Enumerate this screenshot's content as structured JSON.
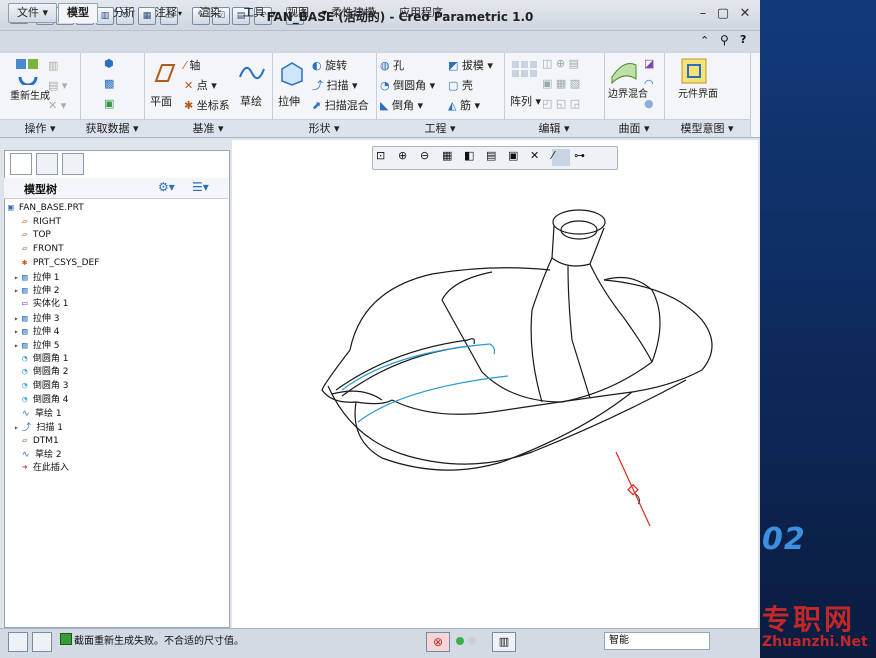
{
  "window": {
    "title": "FAN_BASE (活动的) - Creo Parametric 1.0"
  },
  "tabs": [
    {
      "label": "文件",
      "has_dropdown": true
    },
    {
      "label": "模型"
    },
    {
      "label": "分析"
    },
    {
      "label": "注释"
    },
    {
      "label": "渲染"
    },
    {
      "label": "工具"
    },
    {
      "label": "视图"
    },
    {
      "label": "柔性建模"
    },
    {
      "label": "应用程序"
    }
  ],
  "ribbon": {
    "operations": {
      "regen_label": "重新生成",
      "group": "操作"
    },
    "get_data": {
      "group": "获取数据"
    },
    "datum": {
      "plane": "平面",
      "axis": "轴",
      "point": "点",
      "csys": "坐标系",
      "sketch": "草绘",
      "group": "基准"
    },
    "shape": {
      "extrude": "拉伸",
      "revolve": "旋转",
      "sweep": "扫描",
      "swept_blend": "扫描混合",
      "group": "形状"
    },
    "engineering": {
      "hole": "孔",
      "round": "倒圆角",
      "chamfer": "倒角",
      "draft": "拔模",
      "shell": "壳",
      "rib": "筋",
      "group": "工程"
    },
    "editing": {
      "pattern": "阵列",
      "group": "编辑"
    },
    "surfaces": {
      "boundary_blend": "边界混合",
      "group": "曲面"
    },
    "model_intent": {
      "component_interface": "元件界面",
      "group": "模型意图"
    }
  },
  "model_tree": {
    "title": "模型树",
    "items": [
      {
        "label": "FAN_BASE.PRT",
        "expandable": false
      },
      {
        "label": "RIGHT",
        "expandable": false
      },
      {
        "label": "TOP",
        "expandable": false
      },
      {
        "label": "FRONT",
        "expandable": false
      },
      {
        "label": "PRT_CSYS_DEF",
        "expandable": false
      },
      {
        "label": "拉伸 1",
        "expandable": true
      },
      {
        "label": "拉伸 2",
        "expandable": true
      },
      {
        "label": "实体化 1",
        "expandable": false
      },
      {
        "label": "拉伸 3",
        "expandable": true
      },
      {
        "label": "拉伸 4",
        "expandable": true
      },
      {
        "label": "拉伸 5",
        "expandable": true
      },
      {
        "label": "倒圆角 1",
        "expandable": false
      },
      {
        "label": "倒圆角 2",
        "expandable": false
      },
      {
        "label": "倒圆角 3",
        "expandable": false
      },
      {
        "label": "倒圆角 4",
        "expandable": false
      },
      {
        "label": "草绘 1",
        "expandable": false
      },
      {
        "label": "扫描 1",
        "expandable": true
      },
      {
        "label": "DTM1",
        "expandable": false
      },
      {
        "label": "草绘 2",
        "expandable": false
      },
      {
        "label": "在此插入",
        "expandable": false
      }
    ]
  },
  "status": {
    "message": "截面重新生成失败。不合适的尺寸值。",
    "filter_value": "智能"
  },
  "desktop": {
    "number": "02",
    "watermark_cn": "专职网",
    "watermark_url": "Zhuanzhi.Net"
  },
  "colors": {
    "accent": "#2a6fc0",
    "model_edge": "#1a1a1a",
    "sketch_curve": "#2a9ad0",
    "datum_axis": "#e0281c"
  }
}
